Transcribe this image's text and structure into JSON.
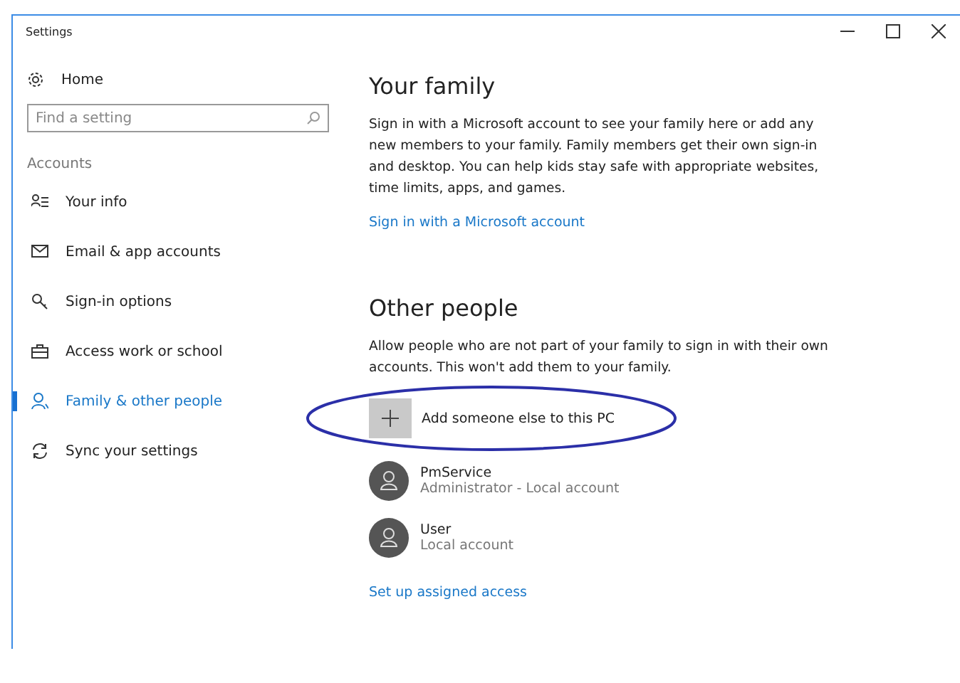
{
  "window": {
    "title": "Settings"
  },
  "sidebar": {
    "home": "Home",
    "search": {
      "placeholder": "Find a setting"
    },
    "section": "Accounts",
    "items": [
      {
        "label": "Your info",
        "selected": false
      },
      {
        "label": "Email & app accounts",
        "selected": false
      },
      {
        "label": "Sign-in options",
        "selected": false
      },
      {
        "label": "Access work or school",
        "selected": false
      },
      {
        "label": "Family & other people",
        "selected": true
      },
      {
        "label": "Sync your settings",
        "selected": false
      }
    ]
  },
  "family": {
    "heading": "Your family",
    "text": "Sign in with a Microsoft account to see your family here or add any new members to your family. Family members get their own sign-in and desktop. You can help kids stay safe with appropriate websites, time limits, apps, and games.",
    "link": "Sign in with a Microsoft account"
  },
  "other_people": {
    "heading": "Other people",
    "text": "Allow people who are not part of your family to sign in with their own accounts. This won't add them to your family.",
    "add_button": "Add someone else to this PC",
    "accounts": [
      {
        "name": "PmService",
        "detail": "Administrator - Local account"
      },
      {
        "name": "User",
        "detail": "Local account"
      }
    ],
    "link": "Set up assigned access"
  }
}
